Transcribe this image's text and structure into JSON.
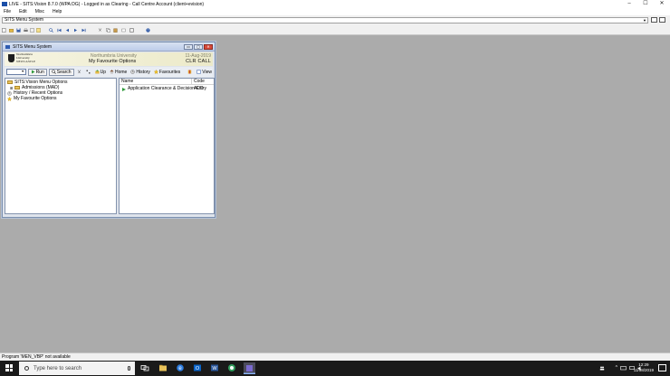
{
  "app_window": {
    "title": "LIVE - SITS:Vision 8.7.0 (WPA:DG) - Logged in as Clearing - Call Centre Account (client+evision)",
    "window_controls": [
      "–",
      "☐",
      "✕"
    ]
  },
  "menu": [
    "File",
    "Edit",
    "Misc",
    "Help"
  ],
  "address_combo": {
    "value": "SITS Menu System"
  },
  "status_bar": {
    "text": "Program 'MEN_VBP' not available"
  },
  "sits_window": {
    "title": "SITS Menu System",
    "controls": [
      "▭",
      "▢",
      "✕"
    ],
    "banner": {
      "logo_lines": [
        "Northumbria",
        "University",
        "NEWCASTLE"
      ],
      "university": "Northumbria University",
      "date": "11-Aug-2019",
      "section_title": "My Favourite Options",
      "code_display": "CLR CALL"
    },
    "toolbar": {
      "combo_value": "",
      "run_label": "Run",
      "search_label": "Search",
      "up_label": "Up",
      "home_label": "Home",
      "history_label": "History",
      "favourites_label": "Favourites",
      "view_label": "View"
    },
    "tree": [
      {
        "label": "SITS:Vision Menu Options",
        "indent": 0
      },
      {
        "label": "Admissions (MAD)",
        "indent": 1
      },
      {
        "label": "History / Recent Options",
        "indent": 0
      },
      {
        "label": "My Favourite Options",
        "indent": 0
      }
    ],
    "list": {
      "columns": [
        "Name",
        "Code"
      ],
      "rows": [
        {
          "name": "Application Clearance & Decision Entry",
          "code": "ACD"
        }
      ]
    }
  },
  "taskbar": {
    "search_placeholder": "Type here to search",
    "time": "12:29",
    "date": "11/08/2019"
  },
  "colors": {
    "desktop": "#ababab",
    "taskbar": "#1a1a1a",
    "window_title": "#bcccea",
    "banner": "#f6f4e2"
  }
}
